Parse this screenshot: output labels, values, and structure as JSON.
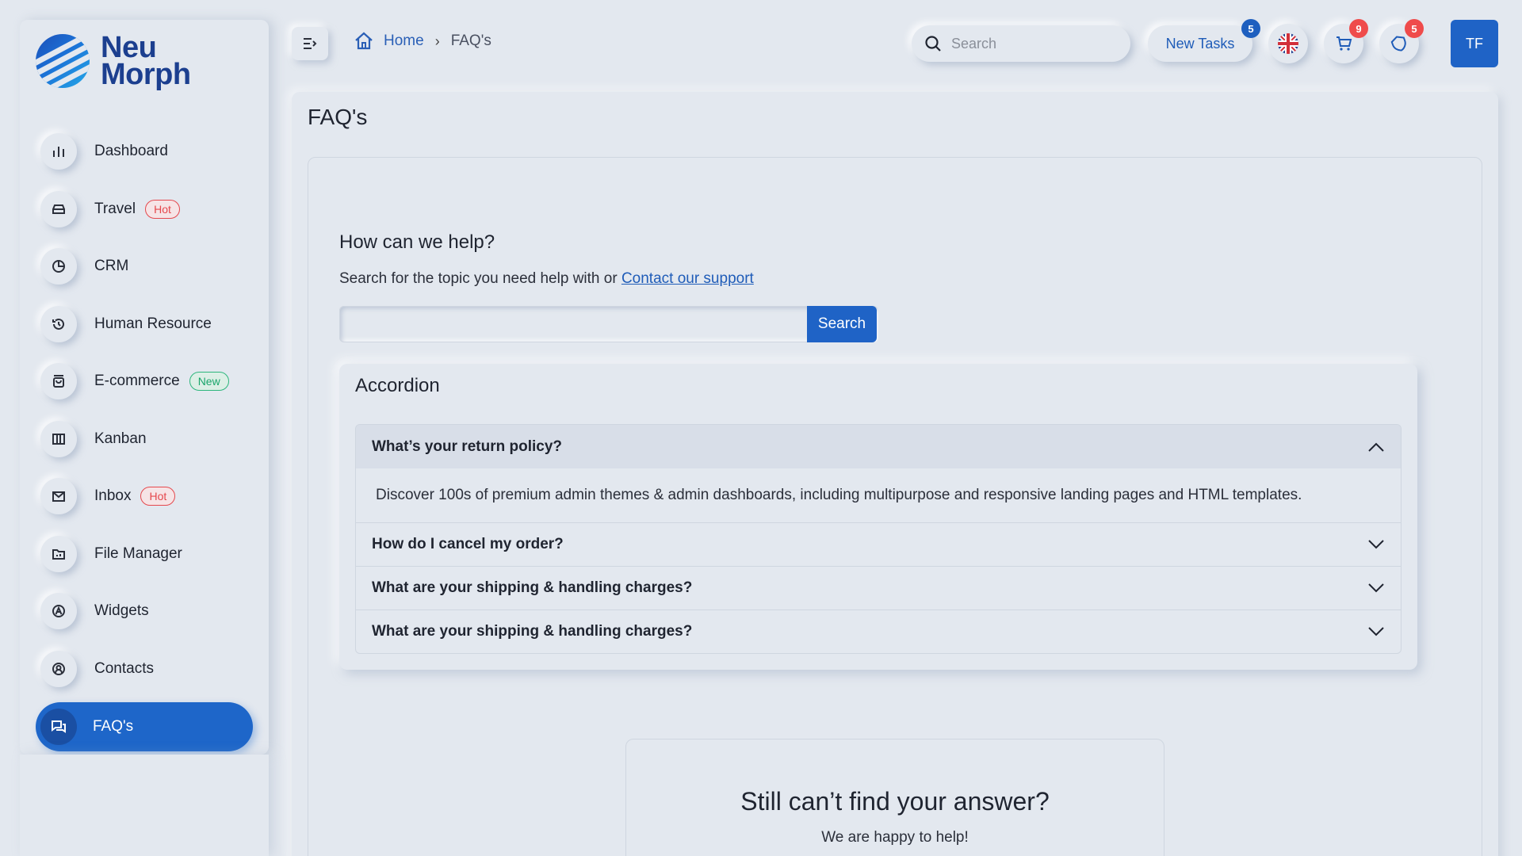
{
  "brand": {
    "line1": "Neu",
    "line2": "Morph"
  },
  "sidebar": {
    "items": [
      {
        "label": "Dashboard",
        "icon": "bar-chart-icon",
        "badge": ""
      },
      {
        "label": "Travel",
        "icon": "car-icon",
        "badge": "Hot"
      },
      {
        "label": "CRM",
        "icon": "pie-chart-icon",
        "badge": ""
      },
      {
        "label": "Human Resource",
        "icon": "history-icon",
        "badge": ""
      },
      {
        "label": "E-commerce",
        "icon": "shopping-bag-icon",
        "badge": "New"
      },
      {
        "label": "Kanban",
        "icon": "columns-icon",
        "badge": ""
      },
      {
        "label": "Inbox",
        "icon": "mail-icon",
        "badge": "Hot"
      },
      {
        "label": "File Manager",
        "icon": "folder-icon",
        "badge": ""
      },
      {
        "label": "Widgets",
        "icon": "widget-icon",
        "badge": ""
      },
      {
        "label": "Contacts",
        "icon": "user-circle-icon",
        "badge": ""
      },
      {
        "label": "FAQ's",
        "icon": "chat-icon",
        "badge": ""
      }
    ],
    "active": "FAQ's"
  },
  "header": {
    "breadcrumb": {
      "home": "Home",
      "current": "FAQ's"
    },
    "search_placeholder": "Search",
    "new_tasks_label": "New Tasks",
    "new_tasks_count": "5",
    "cart_count": "9",
    "notifications_count": "5",
    "avatar_initials": "TF"
  },
  "main": {
    "title": "FAQ's",
    "help": {
      "title": "How can we help?",
      "subtitle": "Search for the topic you need help with or",
      "link": "Contact our support",
      "search_button": "Search",
      "search_value": ""
    },
    "accordion": {
      "title": "Accordion",
      "items": [
        {
          "question": "What’s your return policy?",
          "answer": "Discover 100s of premium admin themes & admin dashboards, including multipurpose and responsive landing pages and HTML templates.",
          "open": true
        },
        {
          "question": "How do I cancel my order?",
          "open": false
        },
        {
          "question": "What are your shipping & handling charges?",
          "open": false
        },
        {
          "question": "What are your shipping & handling charges?",
          "open": false
        }
      ]
    },
    "still": {
      "title": "Still can’t find your answer?",
      "subtitle": "We are happy to help!"
    }
  },
  "colors": {
    "background": "#e3e8ef",
    "primary": "#1f63c6",
    "hot": "#e5484d",
    "new": "#1aa56b"
  }
}
